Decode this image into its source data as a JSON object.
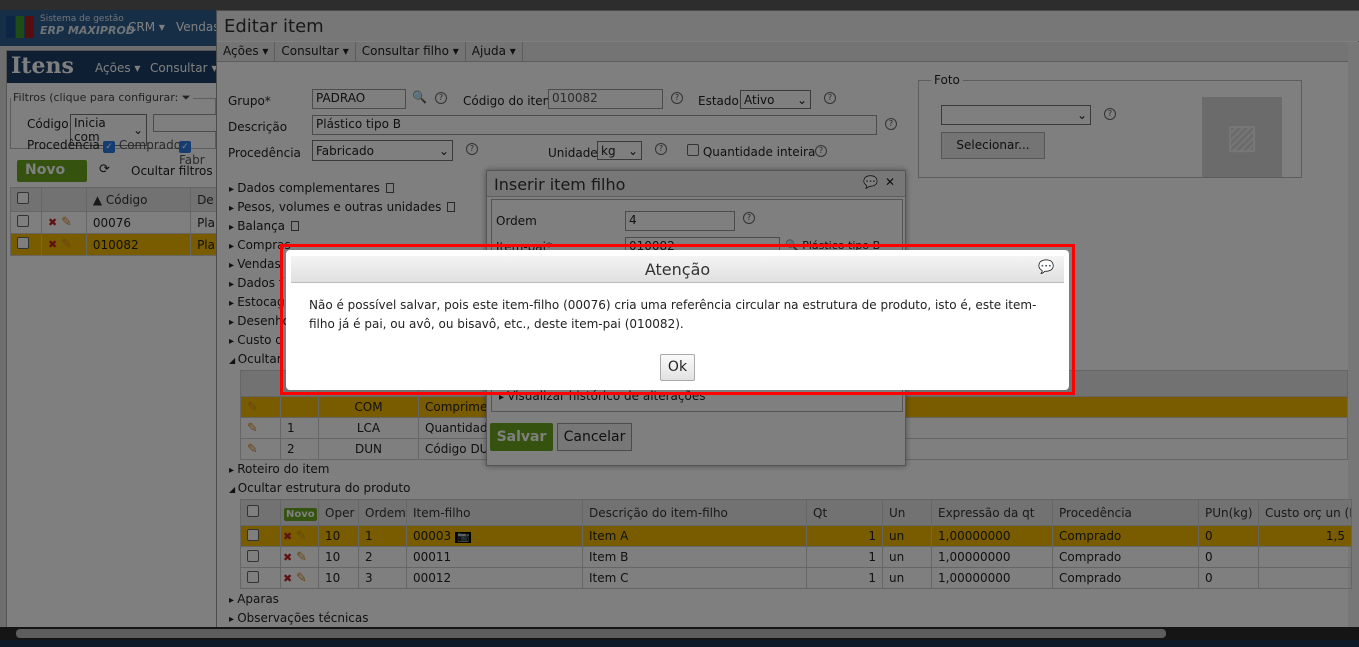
{
  "app": {
    "brand_line1": "Sistema de gestão",
    "brand_line2": "ERP MAXIPROD",
    "nav": [
      "CRM",
      "Vendas"
    ],
    "logo_colors": [
      "#1a4d8c",
      "#3a9a2a",
      "#e8b400",
      "#b01c1c"
    ]
  },
  "itens": {
    "title": "Itens",
    "menu": [
      "Ações",
      "Consultar"
    ],
    "filters_legend": "Filtros (clique para configurar:",
    "codigo_label": "Código",
    "codigo_op": "Inicia com",
    "procedencia_label": "Procedência",
    "proc_options": [
      "Comprado",
      "Fabr"
    ],
    "novo": "Novo",
    "ocultar_filtros": "Ocultar filtros",
    "col_codigo": "Código",
    "col_desc": "De",
    "rows": [
      {
        "codigo": "00076",
        "desc": "Pla",
        "selected": false
      },
      {
        "codigo": "010082",
        "desc": "Pla",
        "selected": true
      }
    ]
  },
  "edit": {
    "title": "Editar item",
    "menu": [
      "Ações",
      "Consultar",
      "Consultar filho",
      "Ajuda"
    ],
    "grupo_label": "Grupo*",
    "grupo": "PADRAO",
    "codigo_label": "Código do item",
    "codigo": "010082",
    "estado_label": "Estado",
    "estado": "Ativo",
    "descricao_label": "Descrição",
    "descricao": "Plástico tipo B",
    "procedencia_label": "Procedência",
    "procedencia": "Fabricado",
    "unidade_label": "Unidade",
    "unidade": "kg",
    "qtd_inteira": "Quantidade inteira",
    "foto_legend": "Foto",
    "foto_select": "",
    "selecionar": "Selecionar...",
    "sections": [
      "Dados complementares",
      "Pesos, volumes e outras unidades",
      "Balança",
      "Compras",
      "Vendas",
      "Dados f",
      "Estocag",
      "Desenho",
      "Custo d",
      "Ocultar c"
    ],
    "char_rows": [
      {
        "n": "",
        "code": "COM",
        "desc": "Comprimen",
        "selected": true
      },
      {
        "n": "1",
        "code": "LCA",
        "desc": "Quantidade",
        "selected": false
      },
      {
        "n": "2",
        "code": "DUN",
        "desc": "Código DUN",
        "selected": false
      }
    ],
    "roteiro": "Roteiro do item",
    "ocultar_estrutura": "Ocultar estrutura do produto",
    "struct_headers": [
      "",
      "Novo",
      "Oper",
      "Ordem",
      "Item-filho",
      "Descrição do item-filho",
      "Qt",
      "Un",
      "Expressão da qt",
      "Procedência",
      "PUn(kg)",
      "Custo orç un (R"
    ],
    "struct_rows": [
      {
        "oper": "10",
        "ordem": "1",
        "item": "00003",
        "desc": "Item A",
        "qt": "1",
        "un": "un",
        "expr": "1,00000000",
        "proc": "Comprado",
        "pun": "0",
        "custo": "1,5",
        "selected": true
      },
      {
        "oper": "10",
        "ordem": "2",
        "item": "00011",
        "desc": "Item B",
        "qt": "1",
        "un": "un",
        "expr": "1,00000000",
        "proc": "Comprado",
        "pun": "0",
        "custo": "",
        "selected": false
      },
      {
        "oper": "10",
        "ordem": "3",
        "item": "00012",
        "desc": "Item C",
        "qt": "1",
        "un": "un",
        "expr": "1,00000000",
        "proc": "Comprado",
        "pun": "0",
        "custo": "",
        "selected": false
      }
    ],
    "aparas": "Aparas",
    "obs": "Observações técnicas"
  },
  "inserir": {
    "title": "Inserir item filho",
    "ordem_label": "Ordem",
    "ordem": "4",
    "itempai_label": "Item-pai*",
    "itempai": "010082",
    "itempai_desc": "Plástico tipo B",
    "historico": "Visualizar histórico de alterações",
    "salvar": "Salvar",
    "cancelar": "Cancelar"
  },
  "alert": {
    "title": "Atenção",
    "message": "Não é possível salvar, pois este item-filho (00076) cria uma referência circular na estrutura de produto, isto é, este item-filho já é pai, ou avô, ou bisavô, etc., deste item-pai (010082).",
    "ok": "Ok"
  }
}
